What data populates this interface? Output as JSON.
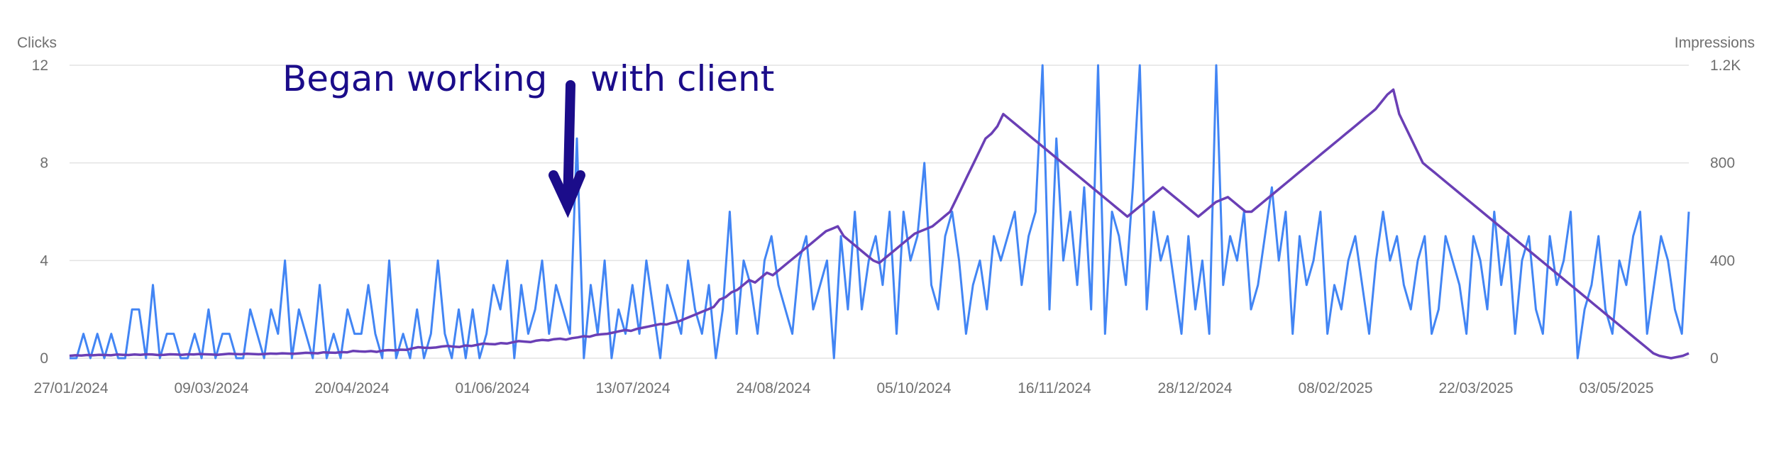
{
  "chart_data": {
    "type": "line",
    "left_axis": {
      "label": "Clicks",
      "range": [
        0,
        12
      ],
      "ticks": [
        "0",
        "4",
        "8",
        "12"
      ]
    },
    "right_axis": {
      "label": "Impressions",
      "range": [
        0,
        1200
      ],
      "ticks": [
        "0",
        "400",
        "800",
        "1.2K"
      ]
    },
    "x_ticks": [
      "27/01/2024",
      "09/03/2024",
      "20/04/2024",
      "01/06/2024",
      "13/07/2024",
      "24/08/2024",
      "05/10/2024",
      "16/11/2024",
      "28/12/2024",
      "08/02/2025",
      "22/03/2025",
      "03/05/2025"
    ],
    "x_range": [
      "27/01/2024",
      "08/06/2025"
    ],
    "grid": true,
    "annotation": {
      "text_left": "Began working",
      "text_right": "with client"
    },
    "series": [
      {
        "name": "Clicks",
        "axis": "left",
        "color": "#4285f4",
        "values": [
          0,
          0,
          1,
          0,
          1,
          0,
          1,
          0,
          0,
          2,
          2,
          0,
          3,
          0,
          1,
          1,
          0,
          0,
          1,
          0,
          2,
          0,
          1,
          1,
          0,
          0,
          2,
          1,
          0,
          2,
          1,
          4,
          0,
          2,
          1,
          0,
          3,
          0,
          1,
          0,
          2,
          1,
          1,
          3,
          1,
          0,
          4,
          0,
          1,
          0,
          2,
          0,
          1,
          4,
          1,
          0,
          2,
          0,
          2,
          0,
          1,
          3,
          2,
          4,
          0,
          3,
          1,
          2,
          4,
          1,
          3,
          2,
          1,
          9,
          0,
          3,
          1,
          4,
          0,
          2,
          1,
          3,
          1,
          4,
          2,
          0,
          3,
          2,
          1,
          4,
          2,
          1,
          3,
          0,
          2,
          6,
          1,
          4,
          3,
          1,
          4,
          5,
          3,
          2,
          1,
          4,
          5,
          2,
          3,
          4,
          0,
          5,
          2,
          6,
          2,
          4,
          5,
          3,
          6,
          1,
          6,
          4,
          5,
          8,
          3,
          2,
          5,
          6,
          4,
          1,
          3,
          4,
          2,
          5,
          4,
          5,
          6,
          3,
          5,
          6,
          12,
          2,
          9,
          4,
          6,
          3,
          7,
          2,
          12,
          1,
          6,
          5,
          3,
          7,
          12,
          2,
          6,
          4,
          5,
          3,
          1,
          5,
          2,
          4,
          1,
          12,
          3,
          5,
          4,
          6,
          2,
          3,
          5,
          7,
          4,
          6,
          1,
          5,
          3,
          4,
          6,
          1,
          3,
          2,
          4,
          5,
          3,
          1,
          4,
          6,
          4,
          5,
          3,
          2,
          4,
          5,
          1,
          2,
          5,
          4,
          3,
          1,
          5,
          4,
          2,
          6,
          3,
          5,
          1,
          4,
          5,
          2,
          1,
          5,
          3,
          4,
          6,
          0,
          2,
          3,
          5,
          2,
          1,
          4,
          3,
          5,
          6,
          1,
          3,
          5,
          4,
          2,
          1,
          6
        ]
      },
      {
        "name": "Impressions",
        "axis": "right",
        "color": "#6a3fb5",
        "values": [
          10,
          12,
          11,
          13,
          12,
          14,
          13,
          12,
          15,
          14,
          13,
          15,
          14,
          16,
          15,
          13,
          14,
          16,
          15,
          14,
          16,
          15,
          17,
          16,
          15,
          14,
          16,
          18,
          17,
          16,
          18,
          17,
          16,
          17,
          19,
          18,
          20,
          19,
          18,
          20,
          22,
          21,
          20,
          24,
          23,
          22,
          25,
          24,
          30,
          28,
          27,
          29,
          26,
          31,
          33,
          32,
          35,
          34,
          40,
          45,
          43,
          42,
          44,
          48,
          50,
          47,
          46,
          52,
          50,
          55,
          60,
          58,
          57,
          62,
          60,
          65,
          70,
          68,
          66,
          72,
          75,
          73,
          78,
          80,
          76,
          82,
          85,
          90,
          88,
          95,
          98,
          100,
          105,
          110,
          115,
          112,
          120,
          125,
          130,
          135,
          140,
          138,
          145,
          150,
          160,
          170,
          180,
          190,
          200,
          210,
          240,
          250,
          270,
          280,
          300,
          320,
          310,
          330,
          350,
          340,
          360,
          380,
          400,
          420,
          440,
          460,
          480,
          500,
          520,
          530,
          540,
          500,
          480,
          460,
          440,
          420,
          400,
          390,
          410,
          430,
          450,
          470,
          490,
          510,
          520,
          530,
          540,
          560,
          580,
          600,
          650,
          700,
          750,
          800,
          850,
          900,
          920,
          950,
          1000,
          980,
          960,
          940,
          920,
          900,
          880,
          860,
          840,
          820,
          800,
          780,
          760,
          740,
          720,
          700,
          680,
          660,
          640,
          620,
          600,
          580,
          600,
          620,
          640,
          660,
          680,
          700,
          680,
          660,
          640,
          620,
          600,
          580,
          600,
          620,
          640,
          650,
          660,
          640,
          620,
          600,
          600,
          620,
          640,
          660,
          680,
          700,
          720,
          740,
          760,
          780,
          800,
          820,
          840,
          860,
          880,
          900,
          920,
          940,
          960,
          980,
          1000,
          1020,
          1050,
          1080,
          1100,
          1000,
          950,
          900,
          850,
          800,
          780,
          760,
          740,
          720,
          700,
          680,
          660,
          640,
          620,
          600,
          580,
          560,
          540,
          520,
          500,
          480,
          460,
          440,
          420,
          400,
          380,
          360,
          340,
          320,
          300,
          280,
          260,
          240,
          220,
          200,
          180,
          160,
          140,
          120,
          100,
          80,
          60,
          40,
          20,
          10,
          5,
          0,
          5,
          10,
          20
        ]
      }
    ]
  }
}
